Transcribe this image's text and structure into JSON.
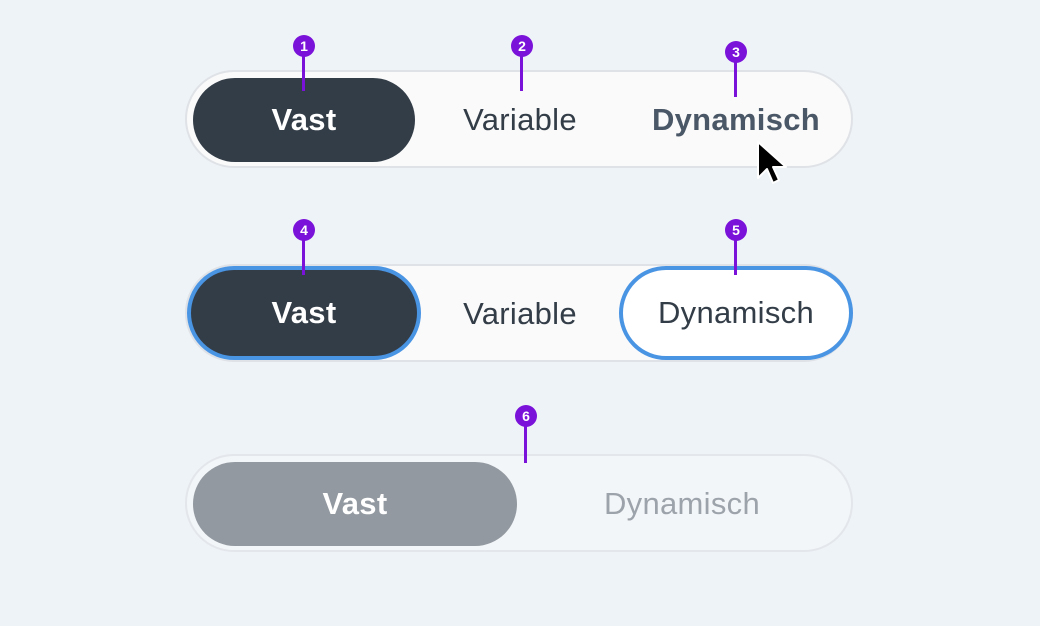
{
  "toggle_default": {
    "options": [
      "Vast",
      "Variable",
      "Dynamisch"
    ]
  },
  "toggle_focus": {
    "options": [
      "Vast",
      "Variable",
      "Dynamisch"
    ]
  },
  "toggle_disabled": {
    "options": [
      "Vast",
      "Dynamisch"
    ]
  },
  "markers": [
    "1",
    "2",
    "3",
    "4",
    "5",
    "6"
  ],
  "colors": {
    "background": "#eef3f8",
    "selected": "#333d48",
    "focus_ring": "#4a94e4",
    "marker": "#7a12d9",
    "disabled_selected": "#9299a0"
  },
  "icons": [
    "mouse-pointer-icon"
  ]
}
